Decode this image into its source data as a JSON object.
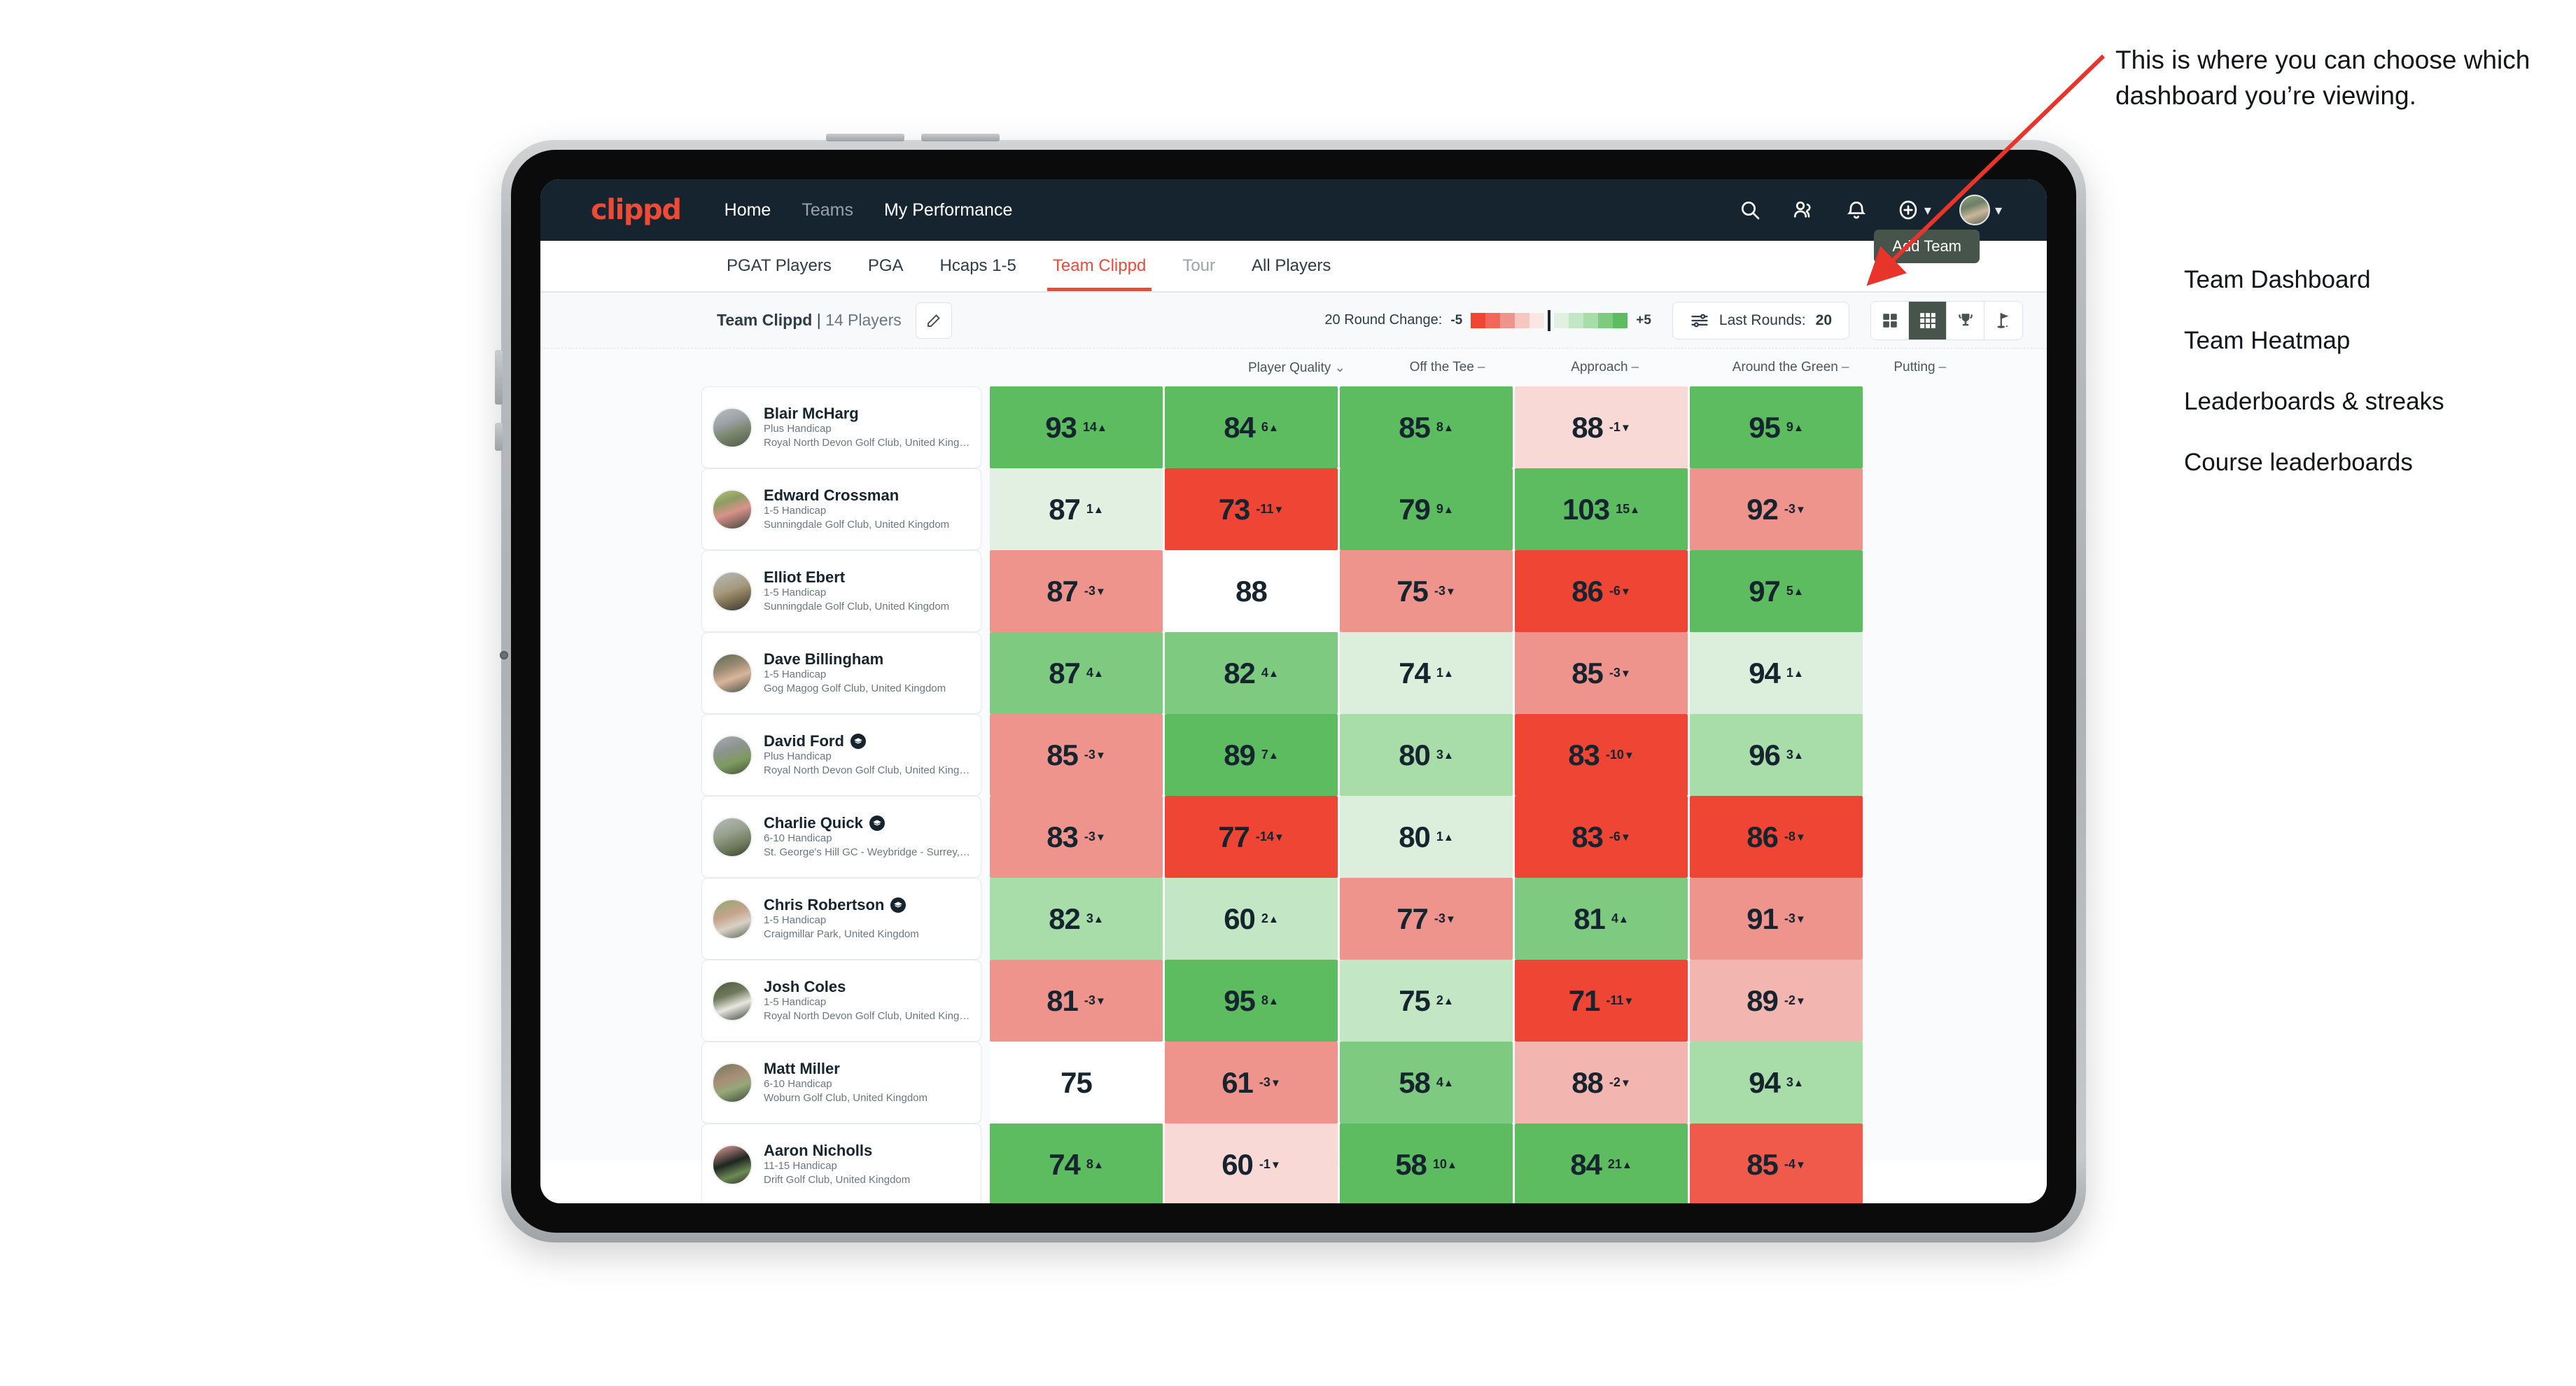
{
  "navbar": {
    "brand": "clippd",
    "links": [
      {
        "label": "Home",
        "dim": false
      },
      {
        "label": "Teams",
        "dim": true
      },
      {
        "label": "My Performance",
        "dim": false
      }
    ],
    "icons": [
      "search-icon",
      "people-icon",
      "notification-bell-icon",
      "plus-circle-icon",
      "avatar-icon"
    ]
  },
  "tabs": [
    {
      "label": "PGAT Players",
      "state": "normal"
    },
    {
      "label": "PGA",
      "state": "normal"
    },
    {
      "label": "Hcaps 1-5",
      "state": "normal"
    },
    {
      "label": "Team Clippd",
      "state": "active"
    },
    {
      "label": "Tour",
      "state": "normal"
    },
    {
      "label": "All Players",
      "state": "normal"
    }
  ],
  "add_team_label": "Add Team",
  "toolbar": {
    "team_name": "Team Clippd",
    "separator": "|",
    "player_count": "14 Players",
    "edit_icon": "pencil-icon",
    "round_change_label": "20 Round Change:",
    "scale_min": "-5",
    "scale_max": "+5",
    "last_rounds_label": "Last Rounds:",
    "last_rounds_value": "20",
    "view_modes": [
      "cards-view-icon",
      "grid-view-icon",
      "trophy-view-icon",
      "course-flag-view-icon"
    ],
    "active_view_index": 1
  },
  "columns": [
    {
      "label": "Player Quality",
      "sym": "⌄"
    },
    {
      "label": "Off the Tee",
      "sym": "–"
    },
    {
      "label": "Approach",
      "sym": "–"
    },
    {
      "label": "Around the Green",
      "sym": "–"
    },
    {
      "label": "Putting",
      "sym": "–"
    }
  ],
  "chart_data": {
    "type": "heatmap",
    "title": "Team Clippd | 14 Players",
    "categories": [
      "Player Quality",
      "Off the Tee",
      "Approach",
      "Around the Green",
      "Putting"
    ],
    "legend": {
      "min": -5,
      "max": 5,
      "position": "top-right",
      "label": "20 Round Change"
    },
    "rows": [
      {
        "name": "Blair McHarg",
        "handicap": "Plus Handicap",
        "club": "Royal North Devon Golf Club, United Kingdom",
        "grad": false,
        "avatar": "linear-gradient(160deg,#b9bdc0 0%,#9aa0a3 38%,#7e8a72 58%,#4d5a46 100%)",
        "values": [
          93,
          84,
          85,
          88,
          95
        ],
        "deltas": [
          14,
          6,
          8,
          -1,
          9
        ],
        "colors": [
          "#5cbc5f",
          "#5cbc5f",
          "#5cbc5f",
          "#f8d9d6",
          "#5cbc5f"
        ]
      },
      {
        "name": "Edward Crossman",
        "handicap": "1-5 Handicap",
        "club": "Sunningdale Golf Club, United Kingdom",
        "grad": false,
        "avatar": "linear-gradient(160deg,#b2c27a 0%,#8e9d63 30%,#d9928b 55%,#3c4438 100%)",
        "values": [
          87,
          73,
          79,
          103,
          92
        ],
        "deltas": [
          1,
          -11,
          9,
          15,
          -3
        ],
        "colors": [
          "#e2f0e2",
          "#ef4535",
          "#5cbc5f",
          "#5cbc5f",
          "#ef948c"
        ]
      },
      {
        "name": "Elliot Ebert",
        "handicap": "1-5 Handicap",
        "club": "Sunningdale Golf Club, United Kingdom",
        "grad": false,
        "avatar": "linear-gradient(160deg,#b5b9bb 0%,#a79a7c 45%,#7a6b4e 70%,#2e3330 100%)",
        "values": [
          87,
          88,
          75,
          86,
          97
        ],
        "deltas": [
          -3,
          null,
          -3,
          -6,
          5
        ],
        "colors": [
          "#ef948c",
          "#ffffff",
          "#ef948c",
          "#ef4535",
          "#5cbc5f"
        ]
      },
      {
        "name": "Dave Billingham",
        "handicap": "1-5 Handicap",
        "club": "Gog Magog Golf Club, United Kingdom",
        "grad": false,
        "avatar": "linear-gradient(160deg,#5c6b4e 0%,#9a8a72 35%,#d9b49a 60%,#4a5248 100%)",
        "values": [
          87,
          82,
          74,
          85,
          94
        ],
        "deltas": [
          4,
          4,
          1,
          -3,
          1
        ],
        "colors": [
          "#7fca81",
          "#7fca81",
          "#dcefdc",
          "#ef948c",
          "#dcefdc"
        ]
      },
      {
        "name": "David Ford",
        "handicap": "Plus Handicap",
        "club": "Royal North Devon Golf Club, United Kingdom",
        "grad": true,
        "avatar": "linear-gradient(160deg,#a8adb0 0%,#8d9490 35%,#7e9a5e 65%,#44513c 100%)",
        "values": [
          85,
          89,
          80,
          83,
          96
        ],
        "deltas": [
          -3,
          7,
          3,
          -10,
          3
        ],
        "colors": [
          "#ef948c",
          "#5cbc5f",
          "#a8dca9",
          "#ef4535",
          "#a8dca9"
        ]
      },
      {
        "name": "Charlie Quick",
        "handicap": "6-10 Handicap",
        "club": "St. George's Hill GC - Weybridge - Surrey, Uni...",
        "grad": true,
        "avatar": "linear-gradient(160deg,#b6babd 0%,#97a08c 40%,#6d7a5c 70%,#39402f 100%)",
        "values": [
          83,
          77,
          80,
          83,
          86
        ],
        "deltas": [
          -3,
          -14,
          1,
          -6,
          -8
        ],
        "colors": [
          "#ef948c",
          "#ef4535",
          "#dcefdc",
          "#ef4535",
          "#ef4535"
        ]
      },
      {
        "name": "Chris Robertson",
        "handicap": "1-5 Handicap",
        "club": "Craigmillar Park, United Kingdom",
        "grad": true,
        "avatar": "linear-gradient(160deg,#8fa871 0%,#c6a48c 40%,#d8d2c6 65%,#5b6452 100%)",
        "values": [
          82,
          60,
          77,
          81,
          91
        ],
        "deltas": [
          3,
          2,
          -3,
          4,
          -3
        ],
        "colors": [
          "#a8dca9",
          "#c3e7c4",
          "#ef948c",
          "#7fca81",
          "#ef948c"
        ]
      },
      {
        "name": "Josh Coles",
        "handicap": "1-5 Handicap",
        "club": "Royal North Devon Golf Club, United Kingdom",
        "grad": false,
        "avatar": "linear-gradient(160deg,#4e5a42 0%,#6d7a5a 35%,#e8e6e0 62%,#3c4436 100%)",
        "values": [
          81,
          95,
          75,
          71,
          89
        ],
        "deltas": [
          -3,
          8,
          2,
          -11,
          -2
        ],
        "colors": [
          "#ef948c",
          "#5cbc5f",
          "#c3e7c4",
          "#ef4535",
          "#f2b5af"
        ]
      },
      {
        "name": "Matt Miller",
        "handicap": "6-10 Handicap",
        "club": "Woburn Golf Club, United Kingdom",
        "grad": false,
        "avatar": "linear-gradient(160deg,#6e7a5c 0%,#a88d76 38%,#95a878 62%,#3f4739 100%)",
        "values": [
          75,
          61,
          58,
          88,
          94
        ],
        "deltas": [
          null,
          -3,
          4,
          -2,
          3
        ],
        "colors": [
          "#ffffff",
          "#ef948c",
          "#7fca81",
          "#f2b5af",
          "#a8dca9"
        ]
      },
      {
        "name": "Aaron Nicholls",
        "handicap": "11-15 Handicap",
        "club": "Drift Golf Club, United Kingdom",
        "grad": false,
        "avatar": "linear-gradient(160deg,#e9a39c 0%,#1e2522 45%,#6e8a54 72%,#2c3328 100%)",
        "values": [
          74,
          60,
          58,
          84,
          85
        ],
        "deltas": [
          8,
          -1,
          10,
          21,
          -4
        ],
        "colors": [
          "#5cbc5f",
          "#f8d9d6",
          "#5cbc5f",
          "#5cbc5f",
          "#ef5a4a"
        ]
      }
    ]
  },
  "annotation": {
    "callout": "This is where you can choose which dashboard you’re viewing.",
    "items": [
      "Team Dashboard",
      "Team Heatmap",
      "Leaderboards & streaks",
      "Course leaderboards"
    ],
    "arrow_color": "#e8342a"
  }
}
